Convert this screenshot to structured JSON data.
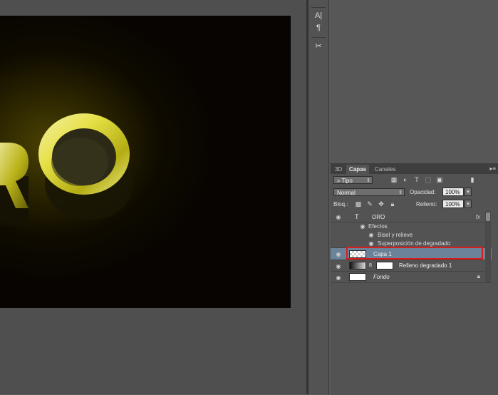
{
  "canvas": {
    "art_text": "RO"
  },
  "toolbar": {
    "tools": [
      {
        "icon": "character-icon",
        "glyph": "A|"
      },
      {
        "icon": "paragraph-icon",
        "glyph": "¶"
      },
      {
        "icon": "tools-icon",
        "glyph": "✂"
      }
    ]
  },
  "layers_panel": {
    "tabs": [
      "3D",
      "Capas",
      "Canales"
    ],
    "menu_glyph": "▸≡",
    "filter": {
      "value": "Tipo"
    },
    "blend_mode": {
      "value": "Normal"
    },
    "opacity": {
      "label": "Opacidad:",
      "value": "100%"
    },
    "lock": {
      "label": "Bloq.:"
    },
    "fill": {
      "label": "Relleno:",
      "value": "100%"
    },
    "layers": [
      {
        "name": "ORO",
        "kind": "type",
        "fx": "fx",
        "effects_label": "Efectos",
        "effects": [
          "Bisel y relieve",
          "Superposición de degradado"
        ]
      },
      {
        "name": "Capa 1",
        "kind": "pixel",
        "selected": true
      },
      {
        "name": "Relleno degradado 1",
        "kind": "fill"
      },
      {
        "name": "Fondo",
        "kind": "background"
      }
    ]
  },
  "colors": {
    "selection": "#6a8399",
    "highlight_box": "#d91d1d",
    "gold": "#e8e24a"
  }
}
